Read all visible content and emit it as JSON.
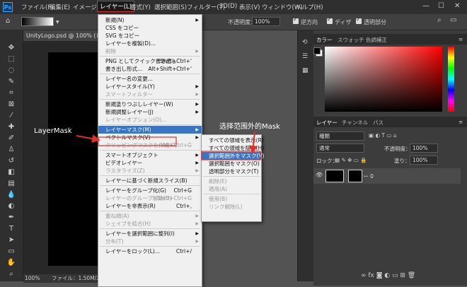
{
  "menubar": {
    "items": [
      "ファイル(F)",
      "編集(E)",
      "イメージ(I)",
      "レイヤー(L)",
      "書式(Y)",
      "選択範囲(S)",
      "フィルター(T)",
      "3D(D)",
      "表示(V)",
      "ウィンドウ(W)",
      "ヘルプ(H)"
    ],
    "active_index": 3
  },
  "optionsbar": {
    "opacity_label": "不透明度：",
    "opacity_value": "100%",
    "reverse_label": "逆方向",
    "dither_label": "ディザ",
    "transparency_label": "透明部分"
  },
  "document": {
    "tab_title": "UnityLogo.psd @ 100% (レイヤー",
    "zoom": "100%",
    "status": "ファイル：1.50M/2.00M"
  },
  "layer_menu": {
    "items": [
      {
        "label": "新規(N)",
        "shortcut": "",
        "submenu": true,
        "disabled": false
      },
      {
        "label": "CSS をコピー",
        "shortcut": "",
        "submenu": false,
        "disabled": false
      },
      {
        "label": "SVG をコピー",
        "shortcut": "",
        "submenu": false,
        "disabled": false
      },
      {
        "label": "レイヤーを複製(D)...",
        "shortcut": "",
        "submenu": false,
        "disabled": false
      },
      {
        "label": "削除",
        "shortcut": "",
        "submenu": true,
        "disabled": true
      },
      {
        "sep": true
      },
      {
        "label": "PNG としてクイック書き出し",
        "shortcut": "Shift+Ctrl+'",
        "submenu": false,
        "disabled": false
      },
      {
        "label": "書き出し形式...",
        "shortcut": "Alt+Shift+Ctrl+'",
        "submenu": false,
        "disabled": false
      },
      {
        "sep": true
      },
      {
        "label": "レイヤー名の変更...",
        "shortcut": "",
        "submenu": false,
        "disabled": false
      },
      {
        "label": "レイヤースタイル(Y)",
        "shortcut": "",
        "submenu": true,
        "disabled": false
      },
      {
        "label": "スマートフィルター",
        "shortcut": "",
        "submenu": true,
        "disabled": true
      },
      {
        "sep": true
      },
      {
        "label": "新規塗りつぶしレイヤー(W)",
        "shortcut": "",
        "submenu": true,
        "disabled": false
      },
      {
        "label": "新規調整レイヤー(J)",
        "shortcut": "",
        "submenu": true,
        "disabled": false
      },
      {
        "label": "レイヤーオプション(O)...",
        "shortcut": "",
        "submenu": false,
        "disabled": true
      },
      {
        "sep": true
      },
      {
        "label": "レイヤーマスク(M)",
        "shortcut": "",
        "submenu": true,
        "disabled": false,
        "highlight": true
      },
      {
        "label": "ベクトルマスク(V)",
        "shortcut": "",
        "submenu": true,
        "disabled": false
      },
      {
        "label": "クリッピングマスクを作成(C)",
        "shortcut": "Alt+Ctrl+G",
        "submenu": false,
        "disabled": true
      },
      {
        "sep": true
      },
      {
        "label": "スマートオブジェクト",
        "shortcut": "",
        "submenu": true,
        "disabled": false
      },
      {
        "label": "ビデオレイヤー",
        "shortcut": "",
        "submenu": true,
        "disabled": false
      },
      {
        "label": "ラスタライズ(Z)",
        "shortcut": "",
        "submenu": true,
        "disabled": true
      },
      {
        "sep": true
      },
      {
        "label": "レイヤーに基づく新規スライス(B)",
        "shortcut": "",
        "submenu": false,
        "disabled": false
      },
      {
        "sep": true
      },
      {
        "label": "レイヤーをグループ化(G)",
        "shortcut": "Ctrl+G",
        "submenu": false,
        "disabled": false
      },
      {
        "label": "レイヤーのグループ解除(U)",
        "shortcut": "Shift+Ctrl+G",
        "submenu": false,
        "disabled": true
      },
      {
        "label": "レイヤーを非表示(R)",
        "shortcut": "Ctrl+,",
        "submenu": false,
        "disabled": false
      },
      {
        "sep": true
      },
      {
        "label": "重ね順(A)",
        "shortcut": "",
        "submenu": true,
        "disabled": true
      },
      {
        "label": "シェイプを結合(H)",
        "shortcut": "",
        "submenu": true,
        "disabled": true
      },
      {
        "sep": true
      },
      {
        "label": "レイヤーを選択範囲に整列(I)",
        "shortcut": "",
        "submenu": true,
        "disabled": false
      },
      {
        "label": "分布(T)",
        "shortcut": "",
        "submenu": true,
        "disabled": true
      },
      {
        "sep": true
      },
      {
        "label": "レイヤーをロック(L)...",
        "shortcut": "Ctrl+/",
        "submenu": false,
        "disabled": false
      }
    ]
  },
  "mask_submenu": {
    "items": [
      {
        "label": "すべての領域を表示(R)",
        "disabled": false
      },
      {
        "label": "すべての領域を隠す(H)",
        "disabled": false
      },
      {
        "label": "選択範囲外をマスク(V)",
        "disabled": false,
        "highlight": true
      },
      {
        "label": "選択範囲をマスク(O)",
        "disabled": false
      },
      {
        "label": "透明部分をマスク(T)",
        "disabled": false
      },
      {
        "sep": true
      },
      {
        "label": "削除(E)",
        "disabled": true
      },
      {
        "label": "適用(A)",
        "disabled": true
      },
      {
        "sep": true
      },
      {
        "label": "使用(B)",
        "disabled": true
      },
      {
        "label": "リンク解除(L)",
        "disabled": true
      }
    ]
  },
  "annotations": {
    "left": "LayerMask",
    "right": "选择范围外的Mask",
    "color": "#e0302b"
  },
  "color_panel": {
    "tabs": [
      "カラー",
      "スウォッチ",
      "色調補正"
    ]
  },
  "layers_panel": {
    "tabs": [
      "レイヤー",
      "チャンネル",
      "パス"
    ],
    "search_placeholder": "種類",
    "blend_mode": "通常",
    "opacity_label": "不透明度：",
    "opacity_value": "100%",
    "lock_label": "ロック：",
    "fill_label": "塗り：",
    "fill_value": "100%",
    "layer_name": "レイヤー 0"
  }
}
